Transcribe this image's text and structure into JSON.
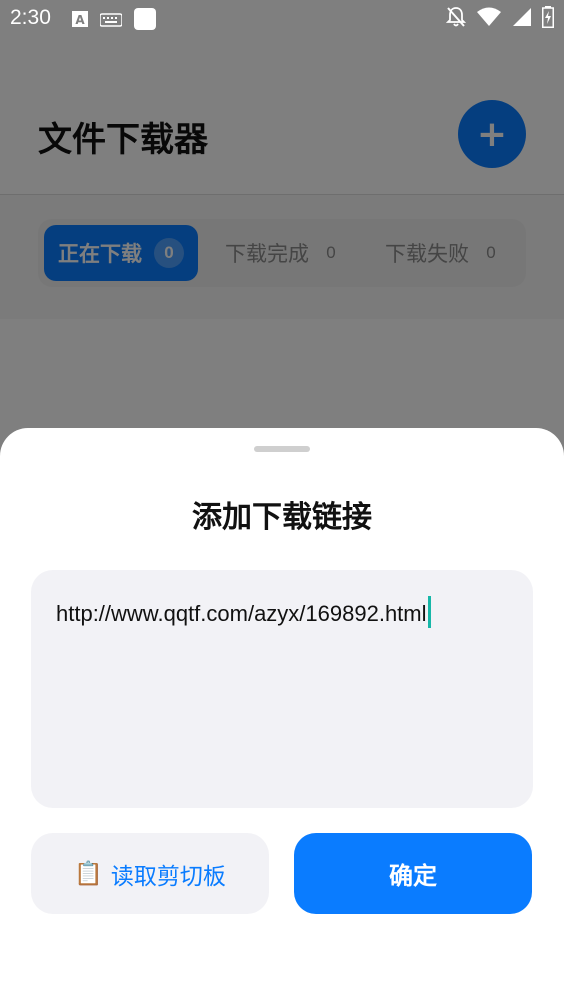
{
  "status_bar": {
    "time": "2:30",
    "icons_left": [
      "text-a-icon",
      "keyboard-icon",
      "square-notification-icon"
    ],
    "icons_right": [
      "notifications-off-icon",
      "wifi-icon",
      "cellular-signal-icon",
      "battery-charging-icon"
    ]
  },
  "app": {
    "title": "文件下载器",
    "add_button_icon": "plus-icon",
    "add_button_glyph": "+",
    "tabs": [
      {
        "label": "正在下载",
        "count": "0",
        "active": true
      },
      {
        "label": "下载完成",
        "count": "0",
        "active": false
      },
      {
        "label": "下载失败",
        "count": "0",
        "active": false
      }
    ]
  },
  "sheet": {
    "title": "添加下载链接",
    "url_value": "http://www.qqtf.com/azyx/169892.html",
    "clipboard_button": {
      "icon": "clipboard-icon",
      "glyph": "📋",
      "label": "读取剪切板"
    },
    "confirm_label": "确定"
  },
  "colors": {
    "accent": "#0a7cff",
    "caret": "#17b7a8",
    "overlay": "rgba(0,0,0,0.5)"
  }
}
